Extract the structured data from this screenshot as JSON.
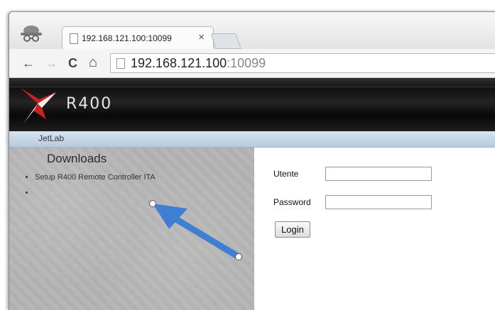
{
  "browser": {
    "tab_title": "192.168.121.100:10099",
    "tab_close": "×",
    "url_host": "192.168.121.100",
    "url_port": ":10099",
    "nav_back": "←",
    "nav_forward": "→",
    "nav_reload": "C",
    "nav_home": "⌂"
  },
  "site": {
    "logo_text": "R400",
    "menu_item": "JetLab"
  },
  "downloads": {
    "heading": "Downloads",
    "items": [
      "Setup R400 Remote Controller ITA",
      ""
    ]
  },
  "login": {
    "user_label": "Utente",
    "user_value": "",
    "password_label": "Password",
    "password_value": "",
    "button_label": "Login"
  },
  "annotation": {
    "arrow_color": "#3f7fd1"
  }
}
